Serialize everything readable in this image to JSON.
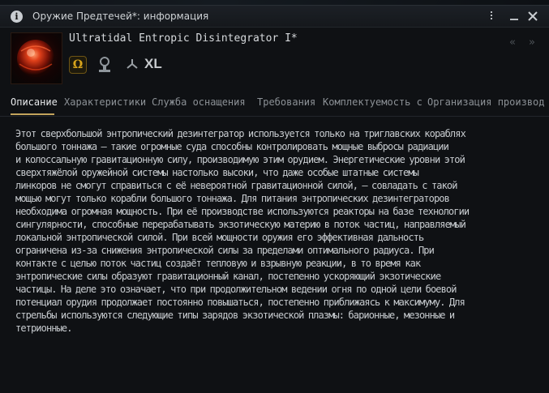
{
  "window": {
    "title": "Оружие Предтечей*: информация"
  },
  "item": {
    "name": "Ultratidal Entropic Disintegrator I*",
    "icon": "entropic-disintegrator-icon",
    "size_label": "XL",
    "badges": [
      "omega-icon",
      "skill-icon",
      "hardpoint-icon"
    ]
  },
  "nav": {
    "back": "«",
    "forward": "»"
  },
  "tabs": [
    {
      "label": "Описание",
      "active": true
    },
    {
      "label": "Характеристики"
    },
    {
      "label": "Служба оснащения"
    },
    {
      "label": "Требования"
    },
    {
      "label": "Комплектуемость с"
    },
    {
      "label": "Организация производ"
    }
  ],
  "description": [
    "Этот сверхбольшой энтропический дезинтегратор используется только на триглавских кораблях",
    "большого тоннажа – такие огромные суда способны контролировать мощные выбросы радиации",
    "и колоссальную гравитационную силу, производимую этим орудием. Энергетические уровни этой",
    "сверхтяжёлой оружейной системы настолько высоки, что даже особые штатные системы",
    "линкоров не смогут справиться с её невероятной гравитационной силой, – совладать с такой",
    "мощью могут только корабли большого тоннажа. Для питания энтропических дезинтеграторов",
    "необходима огромная мощность. При её производстве используются реакторы на базе технологии",
    "сингулярности, способные перерабатывать экзотическую материю в поток частиц, направляемый",
    "локальной энтропической силой. При всей мощности оружия его эффективная дальность",
    "ограничена из-за снижения энтропической силы за пределами оптимального радиуса. При",
    "контакте с целью поток частиц создаёт тепловую и взрывную реакции, в то время как",
    "энтропические силы образуют гравитационный канал, постепенно ускоряющий экзотические",
    "частицы. На деле это означает, что при продолжительном ведении огня по одной цели боевой",
    "потенциал орудия продолжает постоянно повышаться, постепенно приближаясь к максимуму. Для",
    "стрельбы используются следующие типы зарядов экзотической плазмы: барионные, мезонные и",
    "тетрионные."
  ]
}
